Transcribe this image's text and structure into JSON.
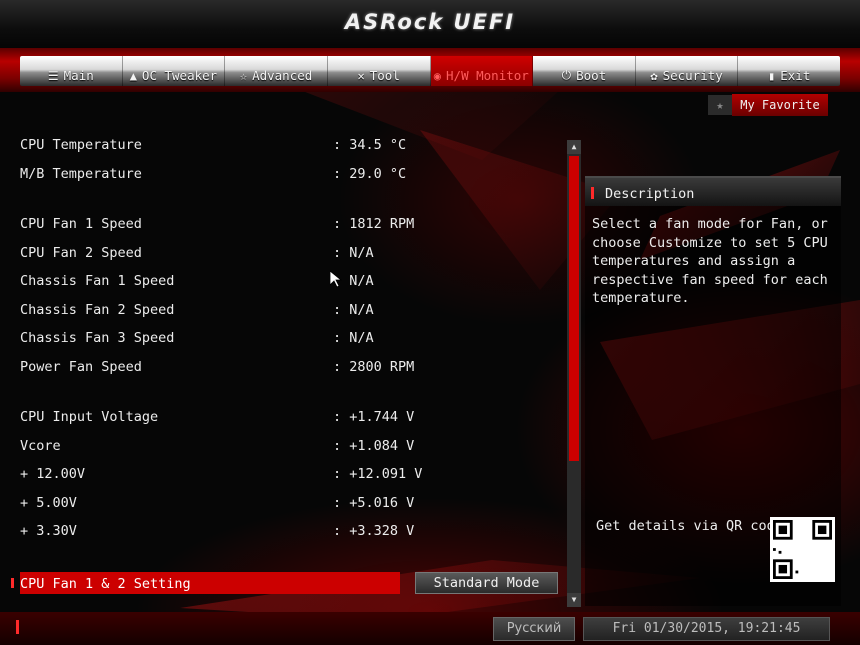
{
  "app": {
    "brand": "ASRock UEFI"
  },
  "nav": {
    "tabs": [
      {
        "label": "Main",
        "icon": "list-icon",
        "glyph": "☰",
        "active": false
      },
      {
        "label": "OC Tweaker",
        "icon": "rocket-icon",
        "glyph": "▲",
        "active": false
      },
      {
        "label": "Advanced",
        "icon": "star-icon",
        "glyph": "☆",
        "active": false
      },
      {
        "label": "Tool",
        "icon": "tools-icon",
        "glyph": "✕",
        "active": false
      },
      {
        "label": "H/W Monitor",
        "icon": "monitor-icon",
        "glyph": "◉",
        "active": true
      },
      {
        "label": "Boot",
        "icon": "power-icon",
        "glyph": "⏻",
        "active": false
      },
      {
        "label": "Security",
        "icon": "shield-icon",
        "glyph": "✿",
        "active": false
      },
      {
        "label": "Exit",
        "icon": "exit-icon",
        "glyph": "▮",
        "active": false
      }
    ]
  },
  "favorite": {
    "label": "My Favorite",
    "icon": "star-icon"
  },
  "monitor": {
    "rows": [
      {
        "label": "CPU Temperature",
        "value": ": 34.5 °C"
      },
      {
        "label": "M/B Temperature",
        "value": ": 29.0 °C"
      },
      {
        "label": "CPU Fan 1 Speed",
        "value": ": 1812 RPM"
      },
      {
        "label": "CPU Fan 2 Speed",
        "value": ": N/A"
      },
      {
        "label": "Chassis Fan 1 Speed",
        "value": ": N/A"
      },
      {
        "label": "Chassis Fan 2 Speed",
        "value": ": N/A"
      },
      {
        "label": "Chassis Fan 3 Speed",
        "value": ": N/A"
      },
      {
        "label": "Power Fan Speed",
        "value": ": 2800 RPM"
      },
      {
        "label": "CPU Input Voltage",
        "value": ": +1.744 V"
      },
      {
        "label": "Vcore",
        "value": ": +1.084 V"
      },
      {
        "label": "+ 12.00V",
        "value": ": +12.091 V"
      },
      {
        "label": "+ 5.00V",
        "value": ": +5.016 V"
      },
      {
        "label": "+ 3.30V",
        "value": ": +3.328 V"
      }
    ],
    "setting": {
      "label": "CPU Fan 1 & 2 Setting",
      "value": "Standard Mode"
    }
  },
  "description": {
    "title": "Description",
    "text": "Select a fan mode for Fan, or choose Customize to set 5 CPU temperatures and assign a respective fan speed for each temperature.",
    "qr_label": "Get details via QR code"
  },
  "footer": {
    "language": "Русский",
    "datetime": "Fri 01/30/2015, 19:21:45"
  },
  "colors": {
    "accent": "#cc0000",
    "text": "#ececec",
    "background": "#060606"
  }
}
